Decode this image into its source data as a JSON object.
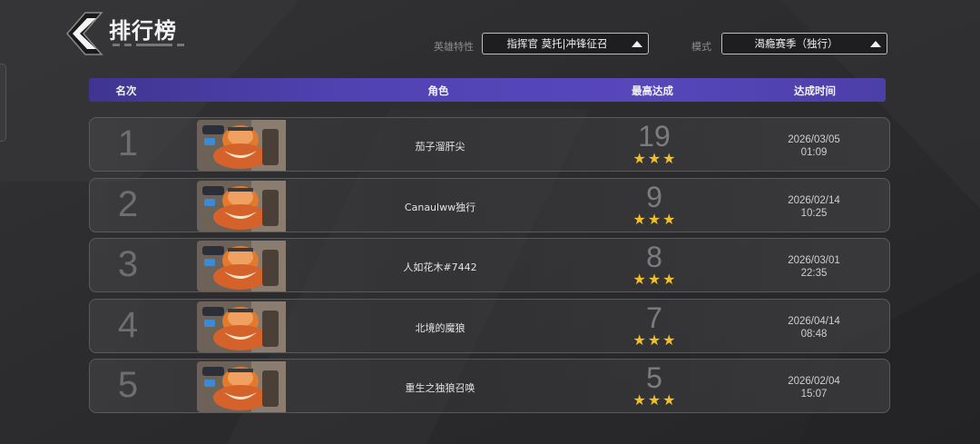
{
  "header": {
    "title": "排行榜",
    "hero_filter_label": "英雄特性",
    "hero_filter_value": "指挥官 莫托|冲锋征召",
    "mode_filter_label": "模式",
    "mode_filter_value": "渴瘾赛季（独行）"
  },
  "columns": {
    "rank": "名次",
    "character": "角色",
    "best": "最高达成",
    "time": "达成时间"
  },
  "rows": [
    {
      "rank": "1",
      "player": "茄子溜肝尖",
      "score": "19",
      "stars": 3,
      "date": "2026/03/05",
      "time": "01:09"
    },
    {
      "rank": "2",
      "player": "Canaulww独行",
      "score": "9",
      "stars": 3,
      "date": "2026/02/14",
      "time": "10:25"
    },
    {
      "rank": "3",
      "player": "人如花木#7442",
      "score": "8",
      "stars": 3,
      "date": "2026/03/01",
      "time": "22:35"
    },
    {
      "rank": "4",
      "player": "北境的魔狼",
      "score": "7",
      "stars": 3,
      "date": "2026/04/14",
      "time": "08:48"
    },
    {
      "rank": "5",
      "player": "重生之独狼召唤",
      "score": "5",
      "stars": 3,
      "date": "2026/02/04",
      "time": "15:07"
    }
  ],
  "colors": {
    "header_bar": "#5243b4",
    "star": "#f0bf2b",
    "background": "#2c2c2e"
  },
  "icons": {
    "back": "chevron-left-icon",
    "dropdown": "triangle-up-icon",
    "star": "star-icon",
    "avatar": "hero-portrait-icon"
  }
}
